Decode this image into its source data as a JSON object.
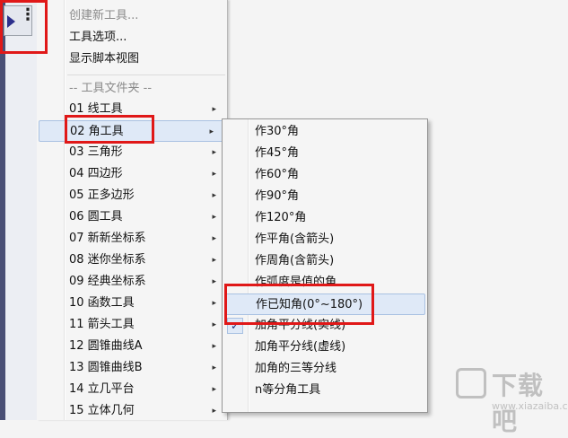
{
  "menu": {
    "top_items": [
      {
        "label": "创建新工具...",
        "disabled": true
      },
      {
        "label": "工具选项...",
        "disabled": false
      },
      {
        "label": "显示脚本视图",
        "disabled": false
      }
    ],
    "folder_header": "-- 工具文件夹 --",
    "folders": [
      "01 线工具",
      "02 角工具",
      "03 三角形",
      "04 四边形",
      "05 正多边形",
      "06 圆工具",
      "07 新新坐标系",
      "08 迷你坐标系",
      "09 经典坐标系",
      "10 函数工具",
      "11 箭头工具",
      "12 圆锥曲线A",
      "13 圆锥曲线B",
      "14 立几平台",
      "15 立体几何"
    ],
    "arrow_glyph": "▸"
  },
  "submenu": {
    "items": [
      "作30°角",
      "作45°角",
      "作60°角",
      "作90°角",
      "作120°角",
      "作平角(含箭头)",
      "作周角(含箭头)",
      "作弧度是值的角",
      "作已知角(0°~180°)",
      "加角平分线(实线)",
      "加角平分线(虚线)",
      "加角的三等分线",
      "n等分角工具"
    ],
    "check_glyph": "✓"
  },
  "toolbar": {
    "dots": "⋮"
  },
  "watermark": {
    "text": "下载吧",
    "url": "www.xiazaiba.com"
  },
  "colors": {
    "highlight": "#dfe9f7",
    "annotation": "#e01818"
  }
}
